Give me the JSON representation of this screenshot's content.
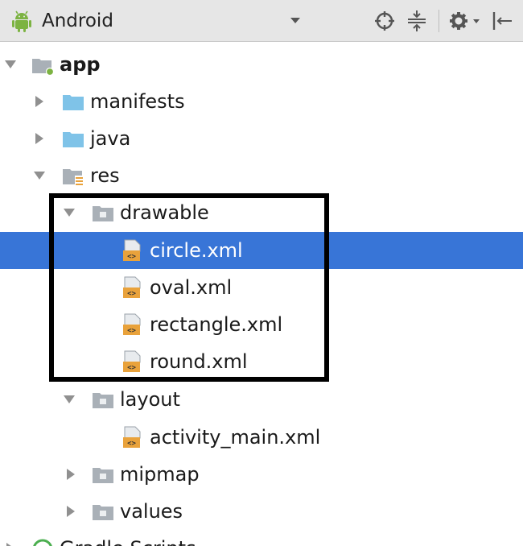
{
  "toolbar": {
    "view_title": "Android",
    "icons": [
      "android-icon",
      "chevron-down-icon",
      "crosshair-icon",
      "collapse-icon",
      "gear-icon",
      "chevron-down-icon",
      "pin-left-icon"
    ]
  },
  "tree": {
    "app": "app",
    "manifests": "manifests",
    "java": "java",
    "res": "res",
    "drawable": "drawable",
    "circle": "circle.xml",
    "oval": "oval.xml",
    "rectangle": "rectangle.xml",
    "round": "round.xml",
    "layout": "layout",
    "activity_main": "activity_main.xml",
    "mipmap": "mipmap",
    "values": "values",
    "gradle_scripts": "Gradle Scripts"
  },
  "colors": {
    "selection": "#3875d7",
    "folder_blue": "#7fc3e8",
    "folder_gray": "#a9b0b7",
    "xml_orange": "#e9a23b",
    "android_green": "#7cb342"
  }
}
